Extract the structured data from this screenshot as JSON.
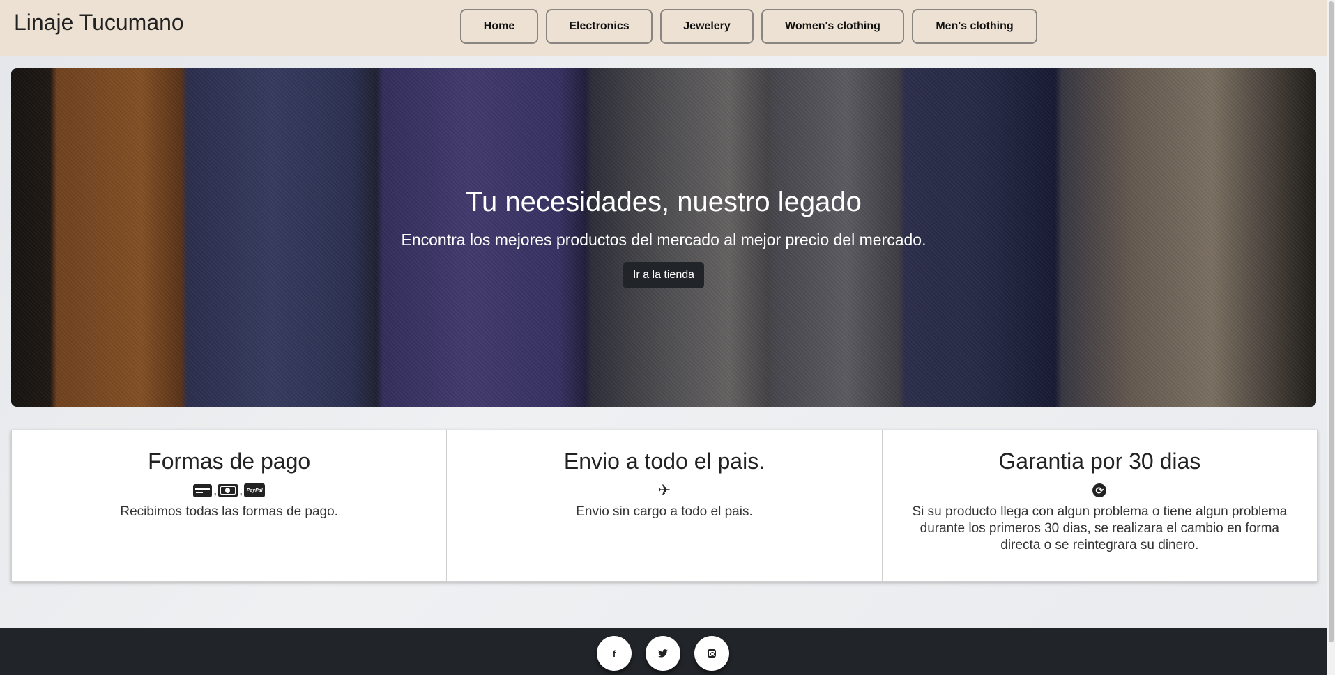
{
  "header": {
    "brand": "Linaje Tucumano",
    "nav": [
      {
        "label": "Home"
      },
      {
        "label": "Electronics"
      },
      {
        "label": "Jewelery"
      },
      {
        "label": "Women's clothing"
      },
      {
        "label": "Men's clothing"
      }
    ]
  },
  "hero": {
    "title": "Tu necesidades, nuestro legado",
    "subtitle": "Encontra los mejores productos del mercado al mejor precio del mercado.",
    "cta": "Ir a la tienda"
  },
  "features": [
    {
      "title": "Formas de pago",
      "icons": [
        "credit-card-icon",
        "cash-icon",
        "paypal-icon"
      ],
      "text": "Recibimos todas las formas de pago."
    },
    {
      "title": "Envio a todo el pais.",
      "icons": [
        "airplane-icon"
      ],
      "text": "Envio sin cargo a todo el pais."
    },
    {
      "title": "Garantia por 30 dias",
      "icons": [
        "sync-icon"
      ],
      "text": "Si su producto llega con algun problema o tiene algun problema durante los primeros 30 dias, se realizara el cambio en forma directa o se reintegrara su dinero."
    }
  ],
  "footer": {
    "social": [
      "facebook-icon",
      "twitter-icon",
      "instagram-icon"
    ]
  },
  "colors": {
    "header_bg": "#ede1d3",
    "footer_bg": "#212529",
    "button_dark": "#212529"
  }
}
